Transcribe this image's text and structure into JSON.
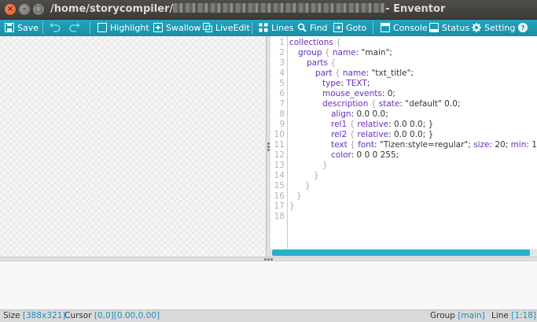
{
  "window": {
    "title_path": "/home/storycompiler/",
    "title_app": "- Enventor"
  },
  "toolbar": {
    "save": "Save",
    "highlight": "Highlight",
    "swallow": "Swallow",
    "liveedit": "LiveEdit",
    "lines": "Lines",
    "find": "Find",
    "goto": "Goto",
    "console": "Console",
    "status": "Status",
    "setting": "Setting"
  },
  "editor": {
    "line_numbers": [
      "1",
      "2",
      "3",
      "4",
      "5",
      "6",
      "7",
      "8",
      "9",
      "10",
      "11",
      "12",
      "13",
      "14",
      "15",
      "16",
      "17",
      "18"
    ],
    "lines": {
      "l1": {
        "kw": "collections",
        "br": " {"
      },
      "l2": {
        "kw": "group",
        "br": " { ",
        "k2": "name",
        "rest": ": \"main\";"
      },
      "l3": {
        "kw": "parts",
        "br": " {"
      },
      "l4": {
        "kw": "part",
        "br": " { ",
        "k2": "name",
        "rest": ": \"txt_title\";"
      },
      "l5": {
        "kw": "type",
        "rest": ": ",
        "k2": "TEXT",
        "end": ";"
      },
      "l6": {
        "kw": "mouse_events",
        "rest": ": 0;"
      },
      "l7": {
        "kw": "description",
        "br": " { ",
        "k2": "state",
        "rest": ": \"default\" 0.0;"
      },
      "l8": {
        "kw": "align",
        "rest": ": 0.0 0.0;"
      },
      "l9": {
        "kw": "rel1",
        "br": " { ",
        "k2": "relative",
        "rest": ": 0.0 0.0; }"
      },
      "l10": {
        "kw": "rel2",
        "br": " { ",
        "k2": "relative",
        "rest": ": 0.0 0.0; }"
      },
      "l11": {
        "kw": "text",
        "br": " { ",
        "k2": "font",
        "rest": ": \"Tizen:style=regular\"; ",
        "k3": "size",
        "rest2": ": 20; ",
        "k4": "min",
        "rest3": ": 1"
      },
      "l12": {
        "kw": "color",
        "rest": ": 0 0 0 255;"
      },
      "l13": {
        "br": "}"
      },
      "l14": {
        "br": "}"
      },
      "l15": {
        "br": "}"
      },
      "l16": {
        "br": "}"
      },
      "l17": {
        "br": "}"
      }
    }
  },
  "statusbar": {
    "size_label": "Size",
    "size_value": "[388x321]",
    "cursor_label": "Cursor",
    "cursor_value1": "[0,0]",
    "cursor_value2": "[0.00,0.00]",
    "group_label": "Group",
    "group_value": "[main]",
    "line_label": "Line",
    "line_value": "[1:18]"
  },
  "colors": {
    "toolbar_bg": "#1a8fa7",
    "keyword": "#6a2fc4",
    "status_value": "#1a8fc0"
  }
}
